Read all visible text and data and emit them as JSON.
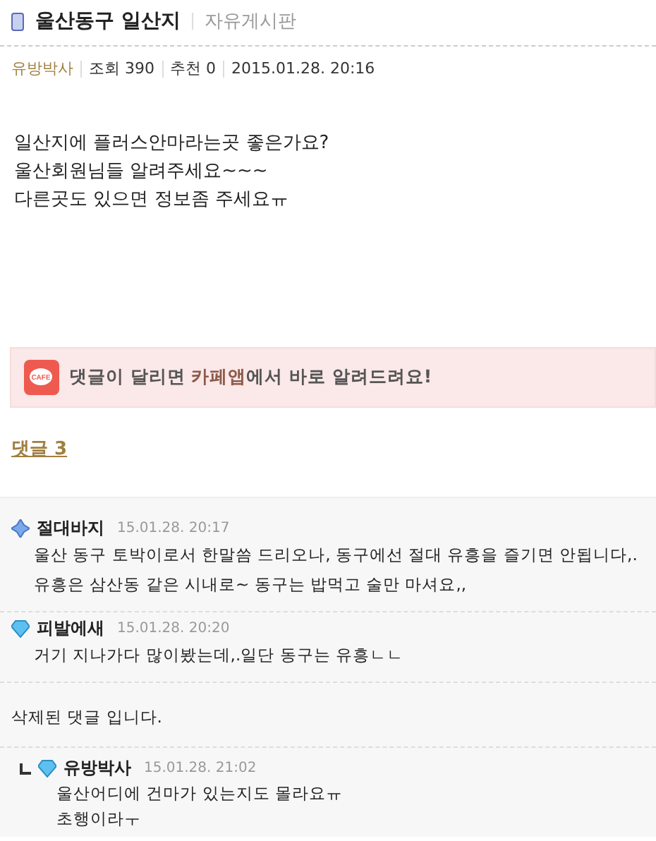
{
  "header": {
    "title": "울산동구 일산지",
    "board": "자유게시판"
  },
  "meta": {
    "author": "유방박사",
    "views": "조회 390",
    "likes": "추천 0",
    "date": "2015.01.28. 20:16"
  },
  "body": [
    "일산지에 플러스안마라는곳 좋은가요?",
    "울산회원님들 알려주세요~~~",
    "다른곳도 있으면 정보좀 주세요ㅠ"
  ],
  "banner": {
    "text": "댓글이 달리면 **카페앱**에서 바로 알려드려요!",
    "icon_label": "CAFE"
  },
  "comments_link": "댓글 3",
  "comments": [
    {
      "kind": "comment",
      "author": "절대바지",
      "date": "15.01.28. 20:17",
      "lines": [
        "울산 동구 토박이로서 한말씀 드리오나, 동구에선 절대 유흥을 즐기면 안됩니다,.",
        "유흥은 삼산동 같은 시내로~ 동구는 밥먹고 술만 마셔요,,"
      ]
    },
    {
      "kind": "comment",
      "author": "피발에새",
      "date": "15.01.28. 20:20",
      "lines": [
        "거기 지나가다 많이봤는데,.일단 동구는 유흥ㄴㄴ"
      ]
    },
    {
      "kind": "deleted",
      "lines": [
        "삭제된 댓글 입니다."
      ]
    },
    {
      "kind": "reply",
      "author": "유방박사",
      "date": "15.01.28. 21:02",
      "lines": [
        "울산어디에 건마가 있는지도 몰라요ㅠ",
        "초행이라ㅜ"
      ]
    }
  ]
}
